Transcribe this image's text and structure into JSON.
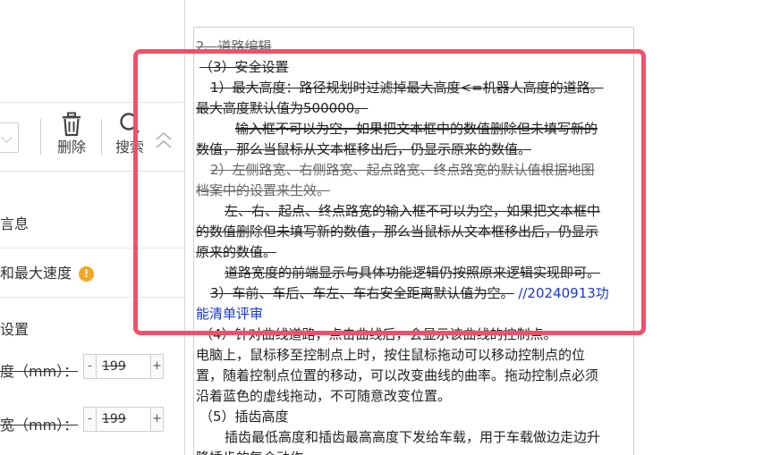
{
  "toolbar": {
    "delete_label": "删除",
    "search_label": "搜索"
  },
  "panel": {
    "info_label": "言息",
    "speed_label": "和最大速度",
    "warn_badge": "!",
    "settings_label": "设置",
    "height_field": {
      "label": "度（mm）：",
      "value": "199",
      "minus": "-",
      "plus": "+"
    },
    "width_field": {
      "label": "宽（mm）：",
      "value": "199",
      "minus": "-",
      "plus": "+"
    }
  },
  "document": {
    "lines": {
      "l01": "2、道路编辑",
      "l02": "（3）安全设置",
      "l03": "1）最大高度：路径规划时过滤掉最大高度<=机器人高度的道路。",
      "l04": "最大高度默认值为500000。",
      "l05": "输入框不可以为空，如果把文本框中的数值删除但未填写新的",
      "l06": "数值，那么当鼠标从文本框移出后，仍显示原来的数值。",
      "l07": "2）左侧路宽、右侧路宽、起点路宽、终点路宽的默认值根据地图",
      "l08": "档案中的设置来生效。",
      "l09": "左、右、起点、终点路宽的输入框不可以为空，如果把文本框中",
      "l10": "的数值删除但未填写新的数值，那么当鼠标从文本框移出后，仍显示",
      "l11": "原来的数值。",
      "l12": "道路宽度的前端显示与具体功能逻辑仍按照原来逻辑实现即可。",
      "l13a": "3）车前、车后、车左、车右安全距离默认值为空。",
      "l13b": "//20240913功",
      "l14": "能清单评审",
      "l15": "（4）针对曲线道路，点击曲线后，会显示该曲线的控制点。",
      "l16": "电脑上，鼠标移至控制点上时，按住鼠标拖动可以移动控制点的位",
      "l17": "置，随着控制点位置的移动，可以改变曲线的曲率。拖动控制点必须",
      "l18": "沿着蓝色的虚线拖动，不可随意改变位置。",
      "l19": "（5）插齿高度",
      "l20": "插齿最低高度和插齿最高高度下发给车载，用于车载做边走边升",
      "l21": "降插齿的复合动作。"
    }
  },
  "colors": {
    "highlight": "#f0506a",
    "comment_blue": "#1a37d6",
    "warning": "#f5a623"
  },
  "icons": [
    "chevron-down-icon",
    "trash-icon",
    "search-icon",
    "chevron-up-icon",
    "warning-icon"
  ]
}
